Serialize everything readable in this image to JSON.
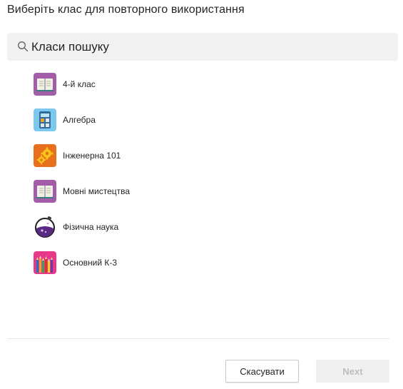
{
  "dialog": {
    "title": "Виберіть клас для повторного використання"
  },
  "search": {
    "placeholder": "Класи пошуку",
    "value": ""
  },
  "classes": [
    {
      "label": "4-й клас",
      "icon": "book-icon",
      "icon_color": "#a35ca8"
    },
    {
      "label": "Алгебра",
      "icon": "calculator-icon",
      "icon_color": "#7cc8ee"
    },
    {
      "label": "Інженерна 101",
      "icon": "gears-icon",
      "icon_color": "#e86f1b"
    },
    {
      "label": "Мовні мистецтва",
      "icon": "book-icon",
      "icon_color": "#a35ca8"
    },
    {
      "label": "Фізична наука",
      "icon": "flask-icon",
      "icon_color": "#5b2a86"
    },
    {
      "label": "Основний К-3",
      "icon": "pencils-icon",
      "icon_color": "#e8388a"
    }
  ],
  "footer": {
    "cancel_label": "Скасувати",
    "next_label": "Next"
  }
}
